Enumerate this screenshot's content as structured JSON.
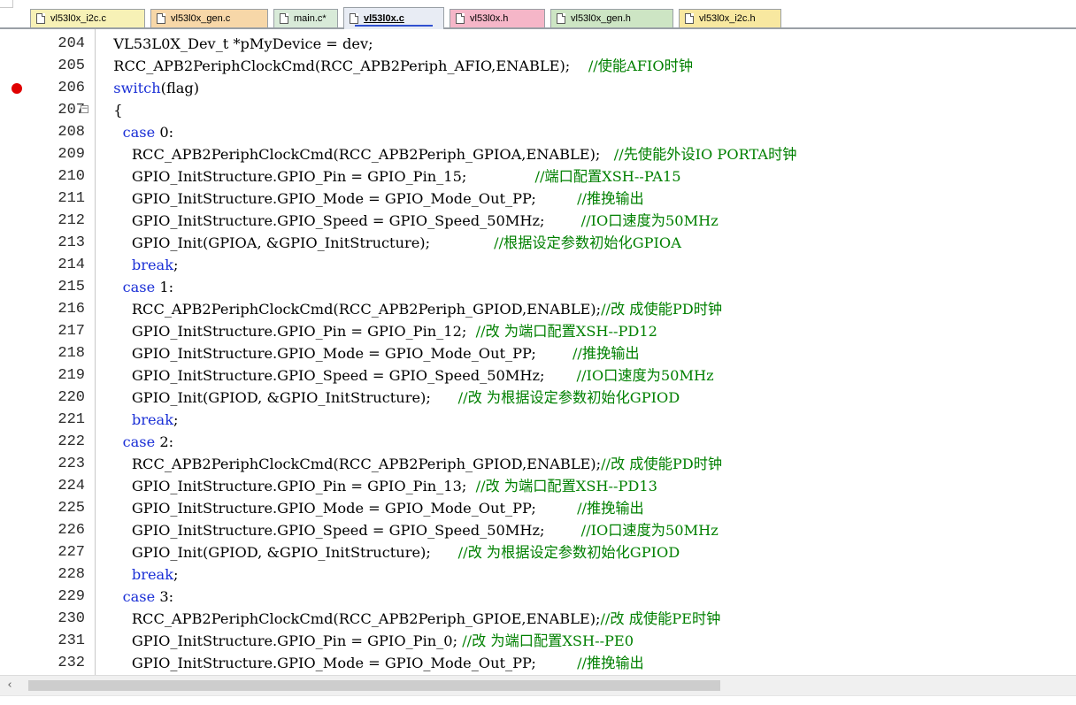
{
  "tabs": [
    {
      "label": "vl53l0x_i2c.c",
      "color": "#f7f1b6",
      "active": false
    },
    {
      "label": "vl53l0x_gen.c",
      "color": "#f7d7a8",
      "active": false
    },
    {
      "label": "main.c*",
      "color": "#d8ead8",
      "active": false
    },
    {
      "label": "vl53l0x.c",
      "color": "#e8ecf4",
      "active": true
    },
    {
      "label": "vl53l0x.h",
      "color": "#f5b6c8",
      "active": false
    },
    {
      "label": "vl53l0x_gen.h",
      "color": "#cde5c4",
      "active": false
    },
    {
      "label": "vl53l0x_i2c.h",
      "color": "#f8e8a0",
      "active": false
    }
  ],
  "editor": {
    "lines": [
      {
        "num": "204",
        "code": "  VL53L0X_Dev_t *pMyDevice = dev;",
        "kw": "",
        "comment": ""
      },
      {
        "num": "205",
        "code": "  RCC_APB2PeriphClockCmd(RCC_APB2Periph_AFIO,ENABLE);    ",
        "kw": "",
        "comment": "//使能AFIO时钟"
      },
      {
        "num": "206",
        "code": "  ",
        "kw": "switch",
        "after": "(flag)",
        "comment": "",
        "breakpoint": true
      },
      {
        "num": "207",
        "code": "  {",
        "kw": "",
        "comment": "",
        "fold": true
      },
      {
        "num": "208",
        "code": "    ",
        "kw": "case",
        "after": " 0:",
        "comment": ""
      },
      {
        "num": "209",
        "code": "      RCC_APB2PeriphClockCmd(RCC_APB2Periph_GPIOA,ENABLE);   ",
        "kw": "",
        "comment": "//先使能外设IO PORTA时钟"
      },
      {
        "num": "210",
        "code": "      GPIO_InitStructure.GPIO_Pin = GPIO_Pin_15;               ",
        "kw": "",
        "comment": "//端口配置XSH--PA15"
      },
      {
        "num": "211",
        "code": "      GPIO_InitStructure.GPIO_Mode = GPIO_Mode_Out_PP;         ",
        "kw": "",
        "comment": "//推挽输出"
      },
      {
        "num": "212",
        "code": "      GPIO_InitStructure.GPIO_Speed = GPIO_Speed_50MHz;        ",
        "kw": "",
        "comment": "//IO口速度为50MHz"
      },
      {
        "num": "213",
        "code": "      GPIO_Init(GPIOA, &GPIO_InitStructure);              ",
        "kw": "",
        "comment": "//根据设定参数初始化GPIOA"
      },
      {
        "num": "214",
        "code": "      ",
        "kw": "break",
        "after": ";",
        "comment": ""
      },
      {
        "num": "215",
        "code": "    ",
        "kw": "case",
        "after": " 1:",
        "comment": ""
      },
      {
        "num": "216",
        "code": "      RCC_APB2PeriphClockCmd(RCC_APB2Periph_GPIOD,ENABLE);",
        "kw": "",
        "comment": "//改 成使能PD时钟"
      },
      {
        "num": "217",
        "code": "      GPIO_InitStructure.GPIO_Pin = GPIO_Pin_12;  ",
        "kw": "",
        "comment": "//改 为端口配置XSH--PD12"
      },
      {
        "num": "218",
        "code": "      GPIO_InitStructure.GPIO_Mode = GPIO_Mode_Out_PP;        ",
        "kw": "",
        "comment": "//推挽输出"
      },
      {
        "num": "219",
        "code": "      GPIO_InitStructure.GPIO_Speed = GPIO_Speed_50MHz;       ",
        "kw": "",
        "comment": "//IO口速度为50MHz"
      },
      {
        "num": "220",
        "code": "      GPIO_Init(GPIOD, &GPIO_InitStructure);      ",
        "kw": "",
        "comment": "//改 为根据设定参数初始化GPIOD"
      },
      {
        "num": "221",
        "code": "      ",
        "kw": "break",
        "after": ";",
        "comment": ""
      },
      {
        "num": "222",
        "code": "    ",
        "kw": "case",
        "after": " 2:",
        "comment": ""
      },
      {
        "num": "223",
        "code": "      RCC_APB2PeriphClockCmd(RCC_APB2Periph_GPIOD,ENABLE);",
        "kw": "",
        "comment": "//改 成使能PD时钟"
      },
      {
        "num": "224",
        "code": "      GPIO_InitStructure.GPIO_Pin = GPIO_Pin_13;  ",
        "kw": "",
        "comment": "//改 为端口配置XSH--PD13"
      },
      {
        "num": "225",
        "code": "      GPIO_InitStructure.GPIO_Mode = GPIO_Mode_Out_PP;         ",
        "kw": "",
        "comment": "//推挽输出"
      },
      {
        "num": "226",
        "code": "      GPIO_InitStructure.GPIO_Speed = GPIO_Speed_50MHz;        ",
        "kw": "",
        "comment": "//IO口速度为50MHz"
      },
      {
        "num": "227",
        "code": "      GPIO_Init(GPIOD, &GPIO_InitStructure);      ",
        "kw": "",
        "comment": "//改 为根据设定参数初始化GPIOD"
      },
      {
        "num": "228",
        "code": "      ",
        "kw": "break",
        "after": ";",
        "comment": ""
      },
      {
        "num": "229",
        "code": "    ",
        "kw": "case",
        "after": " 3:",
        "comment": ""
      },
      {
        "num": "230",
        "code": "      RCC_APB2PeriphClockCmd(RCC_APB2Periph_GPIOE,ENABLE);",
        "kw": "",
        "comment": "//改 成使能PE时钟"
      },
      {
        "num": "231",
        "code": "      GPIO_InitStructure.GPIO_Pin = GPIO_Pin_0; ",
        "kw": "",
        "comment": "//改 为端口配置XSH--PE0"
      },
      {
        "num": "232",
        "code": "      GPIO_InitStructure.GPIO_Mode = GPIO_Mode_Out_PP;         ",
        "kw": "",
        "comment": "//推挽输出"
      }
    ]
  },
  "scrollbar": {
    "left_arrow_icon": "chevron-left-icon",
    "arrow_glyph": "‹"
  },
  "colors": {
    "keyword": "#1a2fd6",
    "comment": "#008000",
    "breakpoint": "#e00000"
  }
}
